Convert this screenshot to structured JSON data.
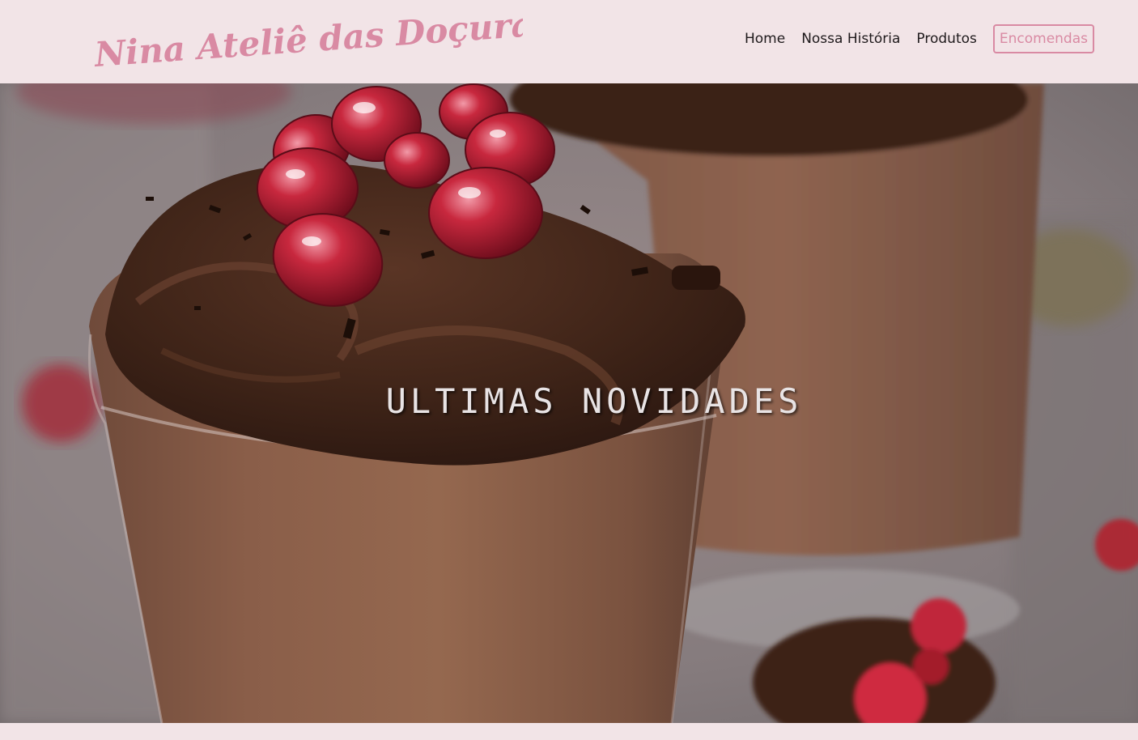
{
  "brand": {
    "name": "Nina Ateliê das Doçuras",
    "color": "#d98aa3"
  },
  "nav": {
    "items": [
      {
        "label": "Home"
      },
      {
        "label": "Nossa História"
      },
      {
        "label": "Produtos"
      },
      {
        "label": "Encomendas"
      }
    ]
  },
  "hero": {
    "title": "ULTIMAS NOVIDADES",
    "image_subject": "chocolate-mousse-with-pomegranate-photo"
  },
  "colors": {
    "header_bg": "#f2e4e7",
    "accent": "#d98aa3",
    "nav_text": "#1f1a1c"
  }
}
